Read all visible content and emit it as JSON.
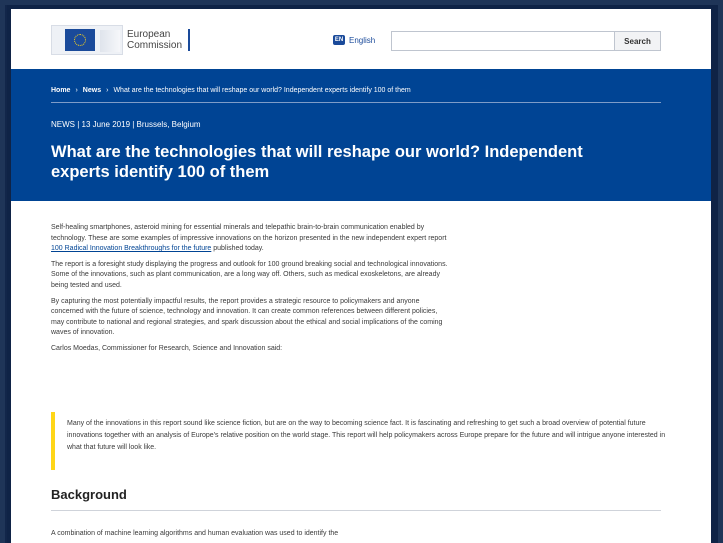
{
  "header": {
    "logo_line1": "European",
    "logo_line2": "Commission",
    "lang_badge": "EN",
    "lang_label": "English",
    "search_placeholder": "",
    "search_button": "Search"
  },
  "breadcrumb": {
    "home": "Home",
    "separator": "›",
    "news": "News",
    "current": "What are the technologies that will reshape our world? Independent experts identify 100 of them"
  },
  "article": {
    "meta": "NEWS | 13 June 2019 | Brussels, Belgium",
    "title": "What are the technologies that will reshape our world? Independent experts identify 100 of them",
    "p1_text": "Self-healing smartphones, asteroid mining for essential minerals and telepathic brain-to-brain communication enabled by technology. These are some examples of impressive innovations on the horizon presented in the new independent expert report ",
    "p1_link": "100 Radical Innovation Breakthroughs for the future",
    "p1_tail": " published today.",
    "p2": "The report is a foresight study displaying the progress and outlook for 100 ground breaking social and technological innovations. Some of the innovations, such as plant communication, are a long way off. Others, such as medical exoskeletons, are already being tested and used.",
    "p3": "By capturing the most potentially impactful results, the report provides a strategic resource to policymakers and anyone concerned with the future of science, technology and innovation. It can create common references between different policies, may contribute to national and regional strategies, and spark discussion about the ethical and social implications of the coming waves of innovation.",
    "p4": "Carlos Moedas, Commissioner for Research, Science and Innovation said:",
    "quote": "Many of the innovations in this report sound like science fiction, but are on the way to becoming science fact. It is fascinating and refreshing to get such a broad overview of potential future innovations together with an analysis of Europe's relative position on the world stage. This report will help policymakers across Europe prepare for the future and will intrigue anyone interested in what that future will look like.",
    "background_heading": "Background",
    "background_p1": "A combination of machine learning algorithms and human evaluation was used to identify the"
  },
  "colors": {
    "brand_blue": "#004494",
    "quote_accent": "#ffd617"
  }
}
